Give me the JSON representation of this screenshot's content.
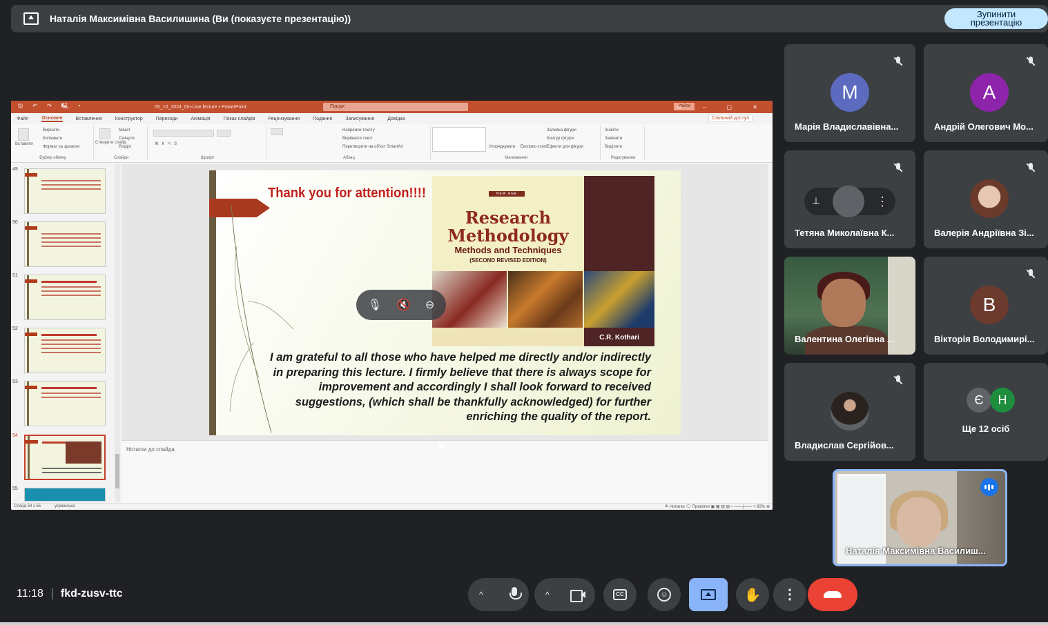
{
  "topbar": {
    "title": "Наталія Максимівна Василишина (Ви (показуєте презентацію))",
    "stop_line1": "Зупинити",
    "stop_line2": "презентацію"
  },
  "ppt": {
    "quick_access": "🖫 ↶ ↷ 🖳 ▾",
    "doc_title": "05_10_2024_On-Line lecture  •  PowerPoint",
    "search_placeholder": "Пошук",
    "signin": "Увійти",
    "window_controls": "▭ – ▢ ✕",
    "tabs": [
      "Файл",
      "Основне",
      "Вставлення",
      "Конструктор",
      "Переходи",
      "Анімація",
      "Показ слайдів",
      "Рецензування",
      "Подання",
      "Записування",
      "Довідка"
    ],
    "active_tab": "Основне",
    "share": "Спільний доступ",
    "ribbon": {
      "clipboard": "Буфер обміну",
      "paste": "Вставити",
      "cut": "Вирізати",
      "copy": "Копіювати",
      "format_painter": "Формат за зразком",
      "slides": "Слайди",
      "new_slide": "Створити слайд",
      "layout": "Макет",
      "reset": "Скинути",
      "section": "Розділ",
      "font": "Шрифт",
      "paragraph": "Абзац",
      "text_direction": "Напрямок тексту",
      "align_text": "Вирівняти текст",
      "smartart": "Перетворити на об'єкт SmartArt",
      "drawing": "Малювання",
      "arrange": "Упорядкувати",
      "quick_styles": "Експрес-стилі",
      "shape_fill": "Заливка фігури",
      "shape_outline": "Контур фігури",
      "shape_effects": "Ефекти для фігури",
      "editing": "Редагування",
      "find": "Знайти",
      "replace": "Замінити",
      "select": "Виділити"
    },
    "thumb_numbers": [
      "49",
      "50",
      "51",
      "52",
      "53",
      "54",
      "55"
    ],
    "selected_thumb": "54",
    "slide": {
      "title": "Thank you for attention!!!!",
      "book_newage": "NEW AGE",
      "book_title": "Research Methodology",
      "book_subtitle": "Methods and Techniques",
      "book_edition": "(SECOND REVISED EDITION)",
      "book_author": "C.R. Kothari",
      "body": "I am grateful to all those who have helped me directly and/or indirectly in preparing this lecture. I firmly believe that there is always scope for improvement and accordingly I shall look forward to received suggestions, (which shall be thankfully acknowledged) for further enriching the quality of the report."
    },
    "notes_placeholder": "Нотатки до слайда",
    "status_slide": "Слайд 54 з 55",
    "status_lang": "українська",
    "status_right": "≜ Нотатки   🗨 Примітки   ▣  ▦  ▥  ▤   –  ——|——  +  93%  ⊕"
  },
  "participants": [
    {
      "name": "Марія Владиславівна...",
      "initial": "М",
      "color": "#5c6bc0",
      "muted": true
    },
    {
      "name": "Андрій Олегович Мо...",
      "initial": "А",
      "color": "#8e24aa",
      "muted": true
    },
    {
      "name": "Тетяна Миколаївна К...",
      "initial": "",
      "color": "#5f6368",
      "muted": true
    },
    {
      "name": "Валерія Андріївна Зі...",
      "initial": "",
      "color": "#a07a6a",
      "muted": true
    },
    {
      "name": "Валентина Олегівна ...",
      "initial": "",
      "color": "",
      "muted": false
    },
    {
      "name": "Вікторія Володимирі...",
      "initial": "В",
      "color": "#6d3b2e",
      "muted": true
    },
    {
      "name": "Владислав Сергійов...",
      "initial": "",
      "color": "#5f6368",
      "muted": true
    }
  ],
  "more": {
    "avatar1": "Є",
    "avatar2": "Н",
    "label": "Ще 12 осіб"
  },
  "self": {
    "name": "Наталія Максимівна Василиш..."
  },
  "meeting": {
    "time": "11:18",
    "code": "fkd-zusv-ttc"
  },
  "controls": {
    "chevron": "^",
    "hand": "✋",
    "dots": "⋮",
    "emoji": "☺",
    "cc": "CC"
  }
}
